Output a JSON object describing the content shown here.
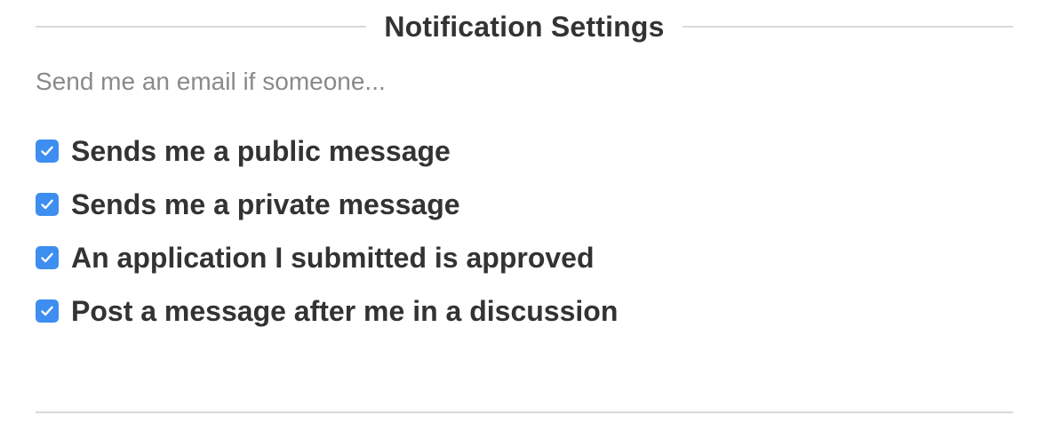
{
  "colors": {
    "accent": "#3d8ef0",
    "text": "#333333",
    "muted": "#8a8a8a",
    "divider": "#d9d9d9"
  },
  "header": {
    "title": "Notification Settings"
  },
  "subtitle": "Send me an email if someone...",
  "options": [
    {
      "label": "Sends me a public message",
      "checked": true,
      "icon": "checkmark-icon"
    },
    {
      "label": "Sends me a private message",
      "checked": true,
      "icon": "checkmark-icon"
    },
    {
      "label": "An application I submitted is approved",
      "checked": true,
      "icon": "checkmark-icon"
    },
    {
      "label": "Post a message after me in a discussion",
      "checked": true,
      "icon": "checkmark-icon"
    }
  ]
}
